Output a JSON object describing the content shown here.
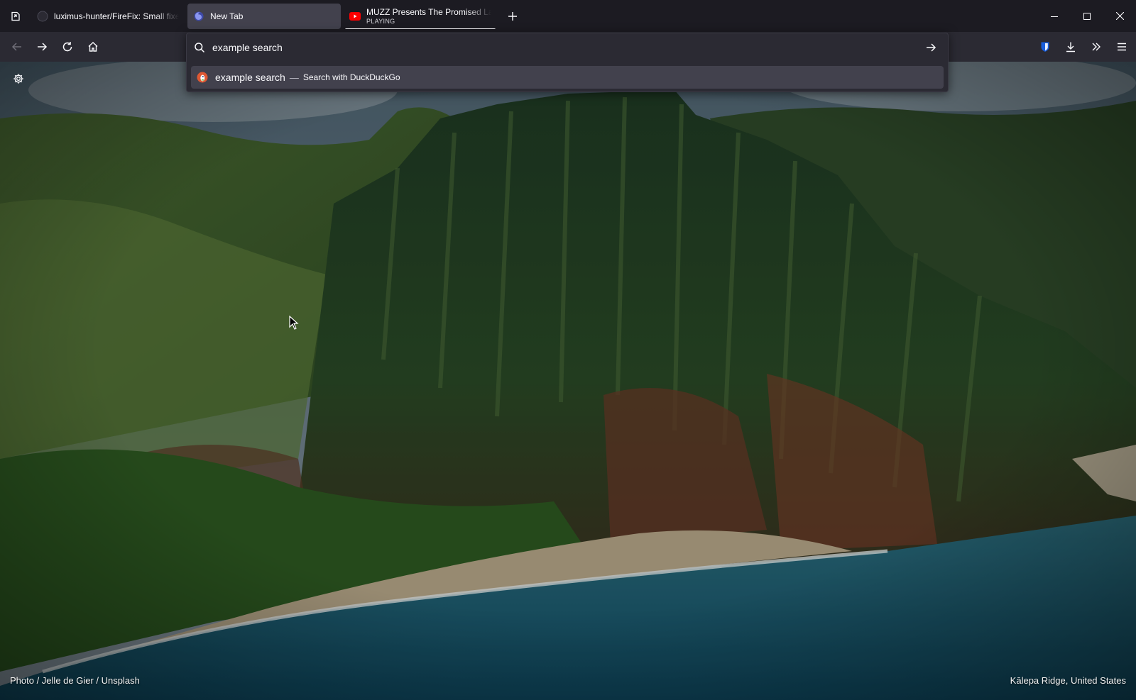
{
  "tabs": [
    {
      "title": "luximus-hunter/FireFix: Small fixe",
      "subtitle": "",
      "favicon": "github-icon",
      "selected": false,
      "playing": false
    },
    {
      "title": "New Tab",
      "subtitle": "",
      "favicon": "firefox-icon",
      "selected": true,
      "playing": false
    },
    {
      "title": "MUZZ Presents The Promised La",
      "subtitle": "PLAYING",
      "favicon": "youtube-icon",
      "selected": false,
      "playing": true
    }
  ],
  "urlbar": {
    "value": "example search",
    "suggestion": {
      "text": "example search",
      "separator": "—",
      "action": "Search with DuckDuckGo",
      "engine_icon": "duckduckgo-icon"
    }
  },
  "toolbar_icons": [
    "back-icon",
    "forward-icon",
    "reload-icon",
    "home-icon",
    "bitwarden-icon",
    "download-icon",
    "overflow-icon",
    "menu-icon"
  ],
  "newtab": {
    "photo_credit": "Photo / Jelle de Gier / Unsplash",
    "location": "Kālepa Ridge, United States"
  },
  "colors": {
    "tabstrip": "#1c1b22",
    "toolbar": "#2b2a33",
    "selected_tab": "#42414d",
    "text": "#fbfbfe",
    "accent_bitwarden": "#175ddc",
    "youtube_red": "#ff0000"
  }
}
